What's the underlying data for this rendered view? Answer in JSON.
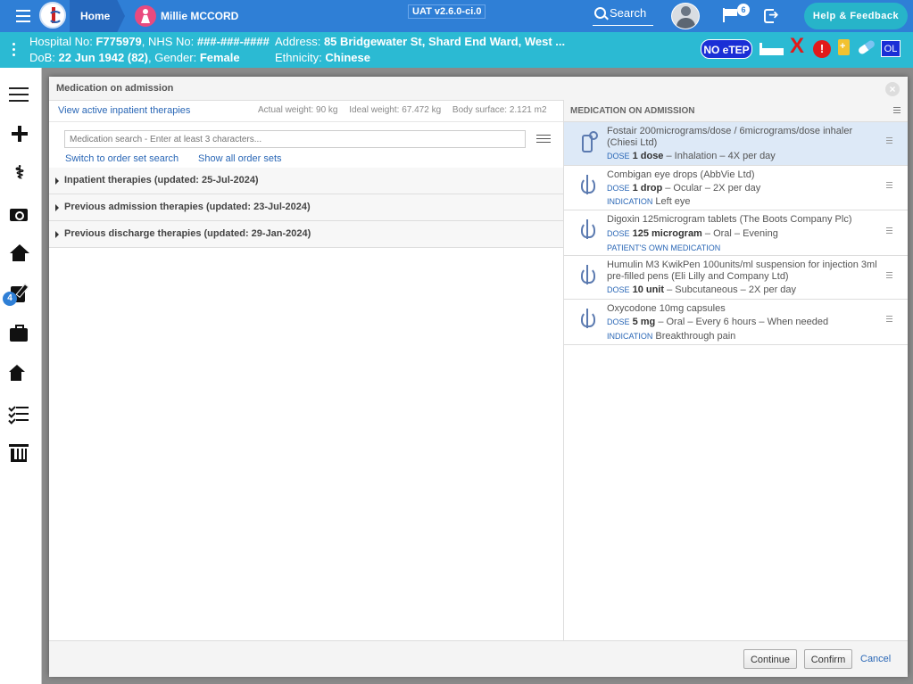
{
  "topbar": {
    "home_label": "Home",
    "patient_name": "Millie MCCORD",
    "version": "UAT v2.6.0-ci.0",
    "search_label": "Search",
    "flag_count": "6",
    "help_label": "Help & Feedback",
    "bg_color": "#2f7fd6"
  },
  "patient_banner": {
    "hospital_label": "Hospital No:",
    "hospital_no": "F775979",
    "nhs_label": ", NHS No:",
    "nhs_no": "###-###-####",
    "dob_label": "DoB:",
    "dob": "22 Jun 1942 (82)",
    "gender_label": ", Gender:",
    "gender": "Female",
    "address_label": "Address:",
    "address": "85 Bridgewater St, Shard End Ward, West ...",
    "ethnicity_label": "Ethnicity:",
    "ethnicity": "Chinese",
    "noetep": "NO eTEP",
    "x_mark": "X",
    "alert_mark": "!",
    "ol": "OL",
    "bg_color": "#2bbad3"
  },
  "sidebar": {
    "items": [
      "list-icon",
      "plus-icon",
      "stethoscope-icon",
      "camera-icon",
      "home-icon",
      "prescription-icon",
      "briefcase-icon",
      "ward-icon",
      "checklist-icon",
      "building-icon"
    ],
    "stethoscope_glyph": "⚕",
    "badge": "4"
  },
  "modal": {
    "title": "Medication on admission",
    "close_glyph": "×",
    "left": {
      "view_active": "View active inpatient therapies",
      "actual_weight": "Actual weight: 90 kg",
      "ideal_weight": "Ideal weight: 67.472 kg",
      "body_surface": "Body surface: 2.121 m2",
      "search_placeholder": "Medication search - Enter at least 3 characters...",
      "switch_link": "Switch to order set search",
      "show_all_link": "Show all order sets",
      "accordions": [
        "Inpatient therapies (updated: 25-Jul-2024)",
        "Previous admission therapies (updated: 23-Jul-2024)",
        "Previous discharge therapies (updated: 29-Jan-2024)"
      ]
    },
    "right": {
      "title": "MEDICATION ON ADMISSION",
      "dose_cap": "DOSE",
      "indication_cap": "INDICATION",
      "meds": [
        {
          "name": "Fostair 200micrograms/dose / 6micrograms/dose inhaler (Chiesi Ltd)",
          "dose": "1 dose",
          "route": " – Inhalation – 4X per day",
          "selected": true
        },
        {
          "name": "Combigan eye drops (AbbVie Ltd)",
          "dose": "1 drop",
          "route": " – Ocular – 2X per day",
          "indication": "Left eye"
        },
        {
          "name": "Digoxin 125microgram tablets (The Boots Company Plc)",
          "dose": "125 microgram",
          "route": " – Oral – Evening",
          "note": "PATIENT'S OWN MEDICATION"
        },
        {
          "name": "Humulin M3 KwikPen 100units/ml suspension for injection 3ml pre-filled pens (Eli Lilly and Company Ltd)",
          "dose": "10 unit",
          "route": " – Subcutaneous – 2X per day"
        },
        {
          "name": "Oxycodone 10mg capsules",
          "dose": "5 mg",
          "route": " – Oral – Every 6 hours – When needed",
          "indication": "Breakthrough pain"
        }
      ]
    },
    "footer": {
      "continue": "Continue",
      "confirm": "Confirm",
      "cancel": "Cancel"
    }
  }
}
